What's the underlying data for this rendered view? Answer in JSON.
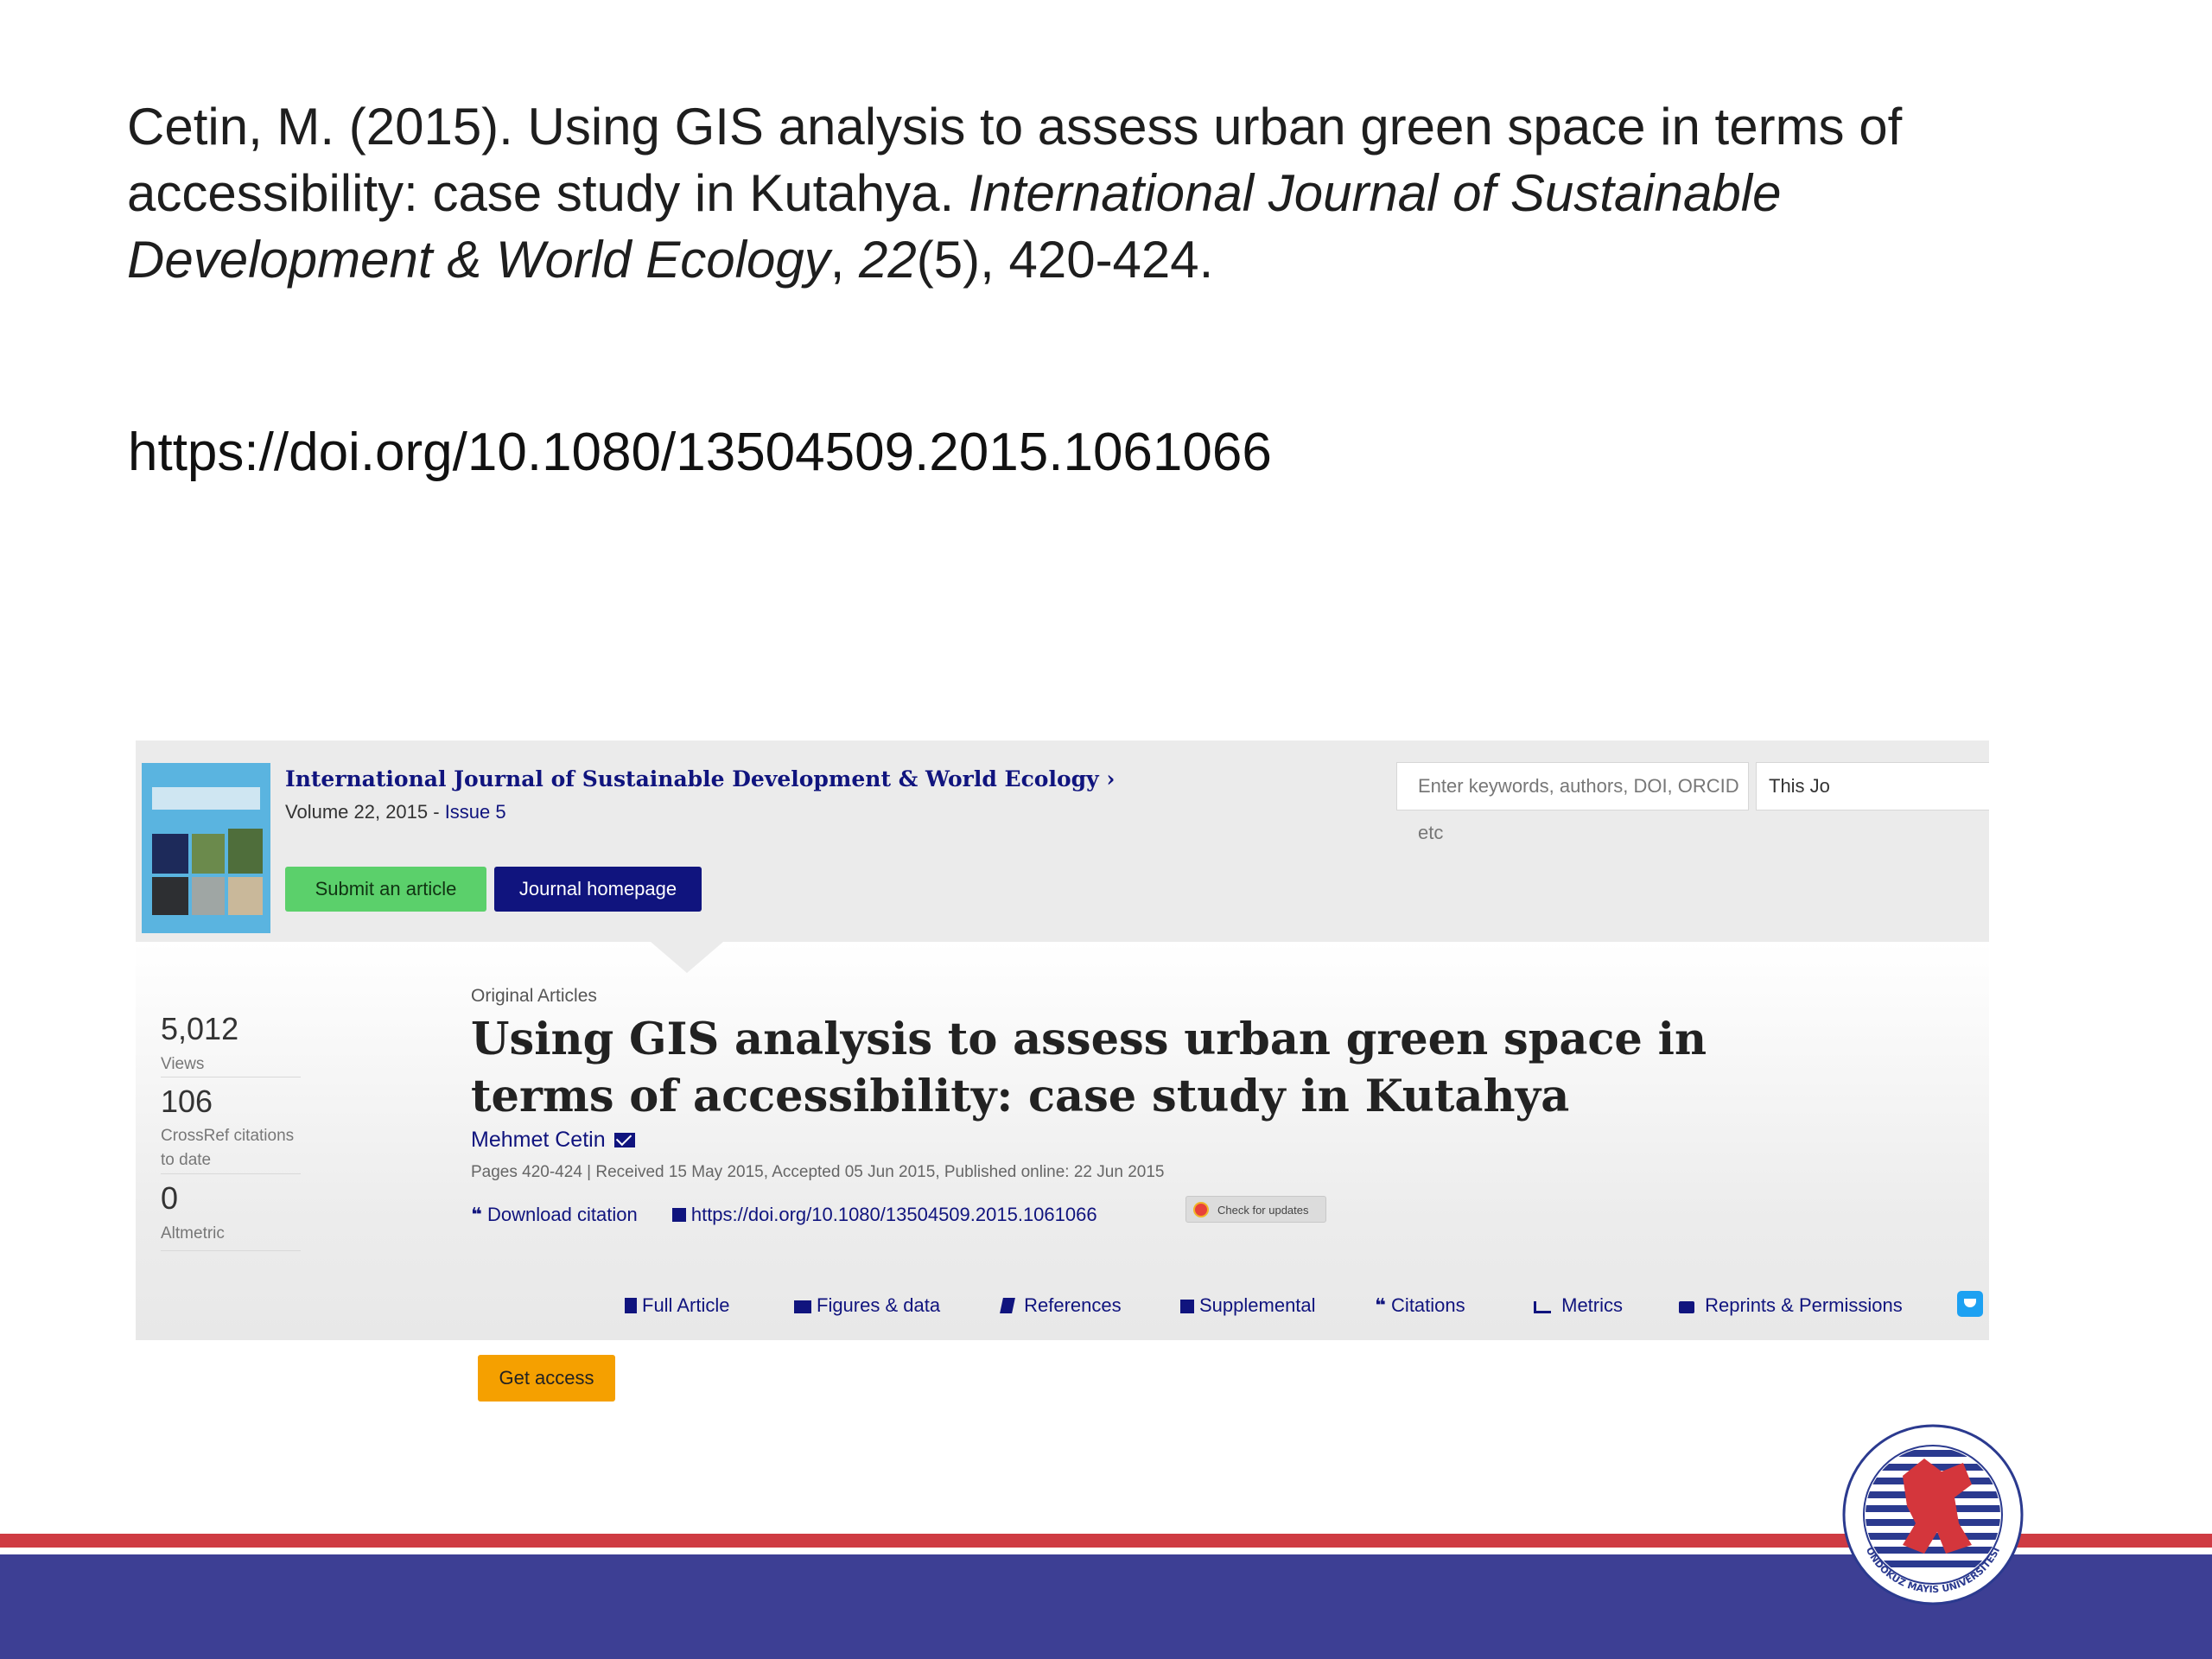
{
  "citation": {
    "authors_year_title": "Cetin, M. (2015). Using GIS analysis to assess urban green space in terms of accessibility: case study in Kutahya.",
    "journal": "International Journal of Sustainable Development & World Ecology",
    "sep1": ",",
    "volume": "22",
    "issue_pages": "(5), 420-424.",
    "doi_url": "https://doi.org/10.1080/13504509.2015.1061066"
  },
  "journal_header": {
    "title": "International Journal of Sustainable Development & World Ecology",
    "chevron": "›",
    "volume": "Volume 22, 2015 - ",
    "issue_link": "Issue 5",
    "submit_label": "Submit an article",
    "homepage_label": "Journal homepage",
    "search_placeholder": "Enter keywords, authors, DOI, ORCID etc",
    "scope_label": "This Jo"
  },
  "metrics": [
    {
      "value": "5,012",
      "label": "Views"
    },
    {
      "value": "106",
      "label": "CrossRef citations to date"
    },
    {
      "value": "0",
      "label": "Altmetric"
    }
  ],
  "article": {
    "type": "Original Articles",
    "title": "Using GIS analysis to assess urban green space in terms of accessibility: case study in Kutahya",
    "author": "Mehmet Cetin",
    "pages_info": "Pages 420-424 | Received 15 May 2015, Accepted 05 Jun 2015, Published online: 22 Jun 2015",
    "download_citation": "Download citation",
    "doi_link": "https://doi.org/10.1080/13504509.2015.1061066",
    "check_updates": "Check for updates"
  },
  "tabs": [
    {
      "label": "Full Article",
      "icon": "document-icon"
    },
    {
      "label": "Figures & data",
      "icon": "image-icon"
    },
    {
      "label": "References",
      "icon": "book-icon"
    },
    {
      "label": "Supplemental",
      "icon": "plus-icon"
    },
    {
      "label": "Citations",
      "icon": "quote-icon"
    },
    {
      "label": "Metrics",
      "icon": "bar-chart-icon"
    },
    {
      "label": "Reprints & Permissions",
      "icon": "printer-icon"
    }
  ],
  "get_access_label": "Get access",
  "logo_text": "ONDOKUZ MAYIS ÜNİVERSİTESİ",
  "colors": {
    "brand_blue": "#10147e",
    "submit_green": "#5bd06b",
    "access_orange": "#f5a000",
    "band_red": "#cf3b43",
    "band_blue": "#3d3f94"
  }
}
